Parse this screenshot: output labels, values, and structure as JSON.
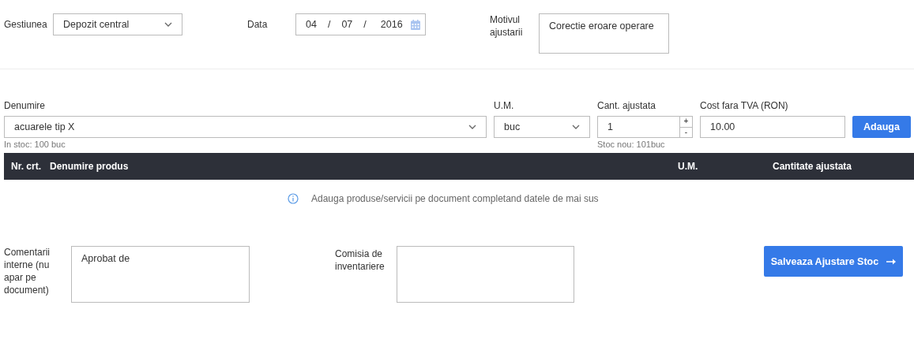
{
  "header": {
    "store": {
      "label": "Gestiunea",
      "value": "Depozit central"
    },
    "date": {
      "label": "Data",
      "parts": [
        "04",
        "/",
        "07",
        "/",
        "2016"
      ]
    },
    "reason": {
      "label": "Motivul ajustarii",
      "value": "Corectie eroare operare"
    }
  },
  "entry": {
    "fields": [
      {
        "kind": "select",
        "label": "Denumire",
        "value": "acuarele tip X",
        "hint": "In stoc: 100 buc"
      },
      {
        "kind": "select",
        "label": "U.M.",
        "value": "buc"
      },
      {
        "kind": "stepper",
        "label": "Cant. ajustata",
        "value": "1",
        "plus": "+",
        "minus": "-",
        "hint": "Stoc nou: 101buc"
      },
      {
        "kind": "text",
        "label": "Cost fara TVA (RON)",
        "value": "10.00"
      }
    ],
    "button": "Adauga"
  },
  "table": {
    "columns": [
      "Nr. crt.",
      "Denumire produs",
      "U.M.",
      "Cantitate ajustata"
    ],
    "empty_message": "Adauga produse/servicii pe document completand datele de mai sus"
  },
  "footer": {
    "comments": {
      "label": "Comentarii interne (nu apar pe document)",
      "value": "Aprobat de"
    },
    "commission": {
      "label": "Comisia de inventariere"
    },
    "save_button": "Salveaza Ajustare Stoc"
  }
}
